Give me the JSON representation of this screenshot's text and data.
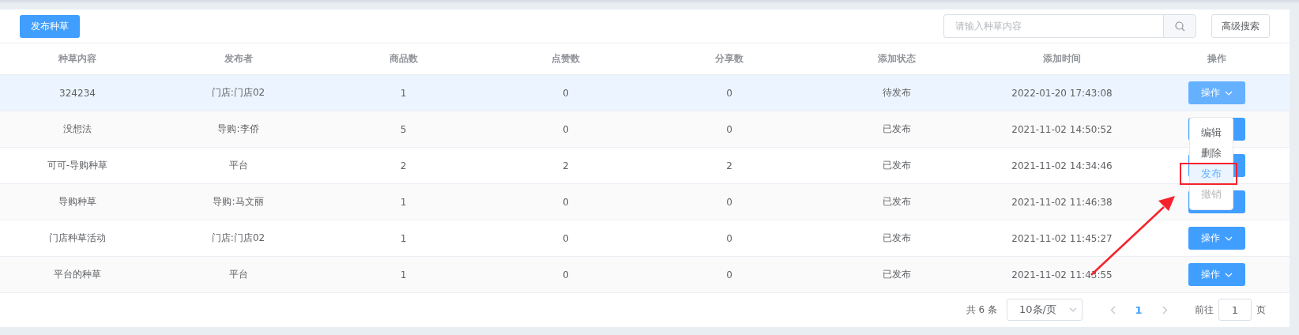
{
  "toolbar": {
    "publish_button": "发布种草",
    "search": {
      "placeholder": "请输入种草内容"
    },
    "advanced_search_button": "高级搜索"
  },
  "table": {
    "columns": [
      "种草内容",
      "发布者",
      "商品数",
      "点赞数",
      "分享数",
      "添加状态",
      "添加时间",
      "操作"
    ],
    "rows": [
      {
        "cells": [
          "324234",
          "门店:门店02",
          "1",
          "0",
          "0",
          "待发布",
          "2022-01-20 17:43:08"
        ],
        "highlighted": true,
        "action": "操作"
      },
      {
        "cells": [
          "没想法",
          "导购:李侨",
          "5",
          "0",
          "0",
          "已发布",
          "2021-11-02 14:50:52"
        ],
        "highlighted": false
      },
      {
        "cells": [
          "可可-导购种草",
          "平台",
          "2",
          "2",
          "2",
          "已发布",
          "2021-11-02 14:34:46"
        ],
        "highlighted": false
      },
      {
        "cells": [
          "导购种草",
          "导购:马文丽",
          "1",
          "0",
          "0",
          "已发布",
          "2021-11-02 11:46:38"
        ],
        "highlighted": false
      },
      {
        "cells": [
          "门店种草活动",
          "门店:门店02",
          "1",
          "0",
          "0",
          "已发布",
          "2021-11-02 11:45:27"
        ],
        "highlighted": false,
        "action": "操作"
      },
      {
        "cells": [
          "平台的种草",
          "平台",
          "1",
          "0",
          "0",
          "已发布",
          "2021-11-02 11:43:55"
        ],
        "highlighted": false,
        "action": "操作"
      }
    ]
  },
  "action_menu": [
    {
      "label": "编辑",
      "selected": false,
      "disabled": false
    },
    {
      "label": "删除",
      "selected": false,
      "disabled": false
    },
    {
      "label": "发布",
      "selected": true,
      "disabled": false
    },
    {
      "label": "撤销",
      "selected": false,
      "disabled": true
    }
  ],
  "pagination": {
    "total": "共 6 条",
    "page_size": "10条/页",
    "pages": [
      {
        "label": "1",
        "selected": true
      }
    ],
    "goto_label": "前往",
    "goto_value": "1",
    "goto_suffix": "页"
  }
}
